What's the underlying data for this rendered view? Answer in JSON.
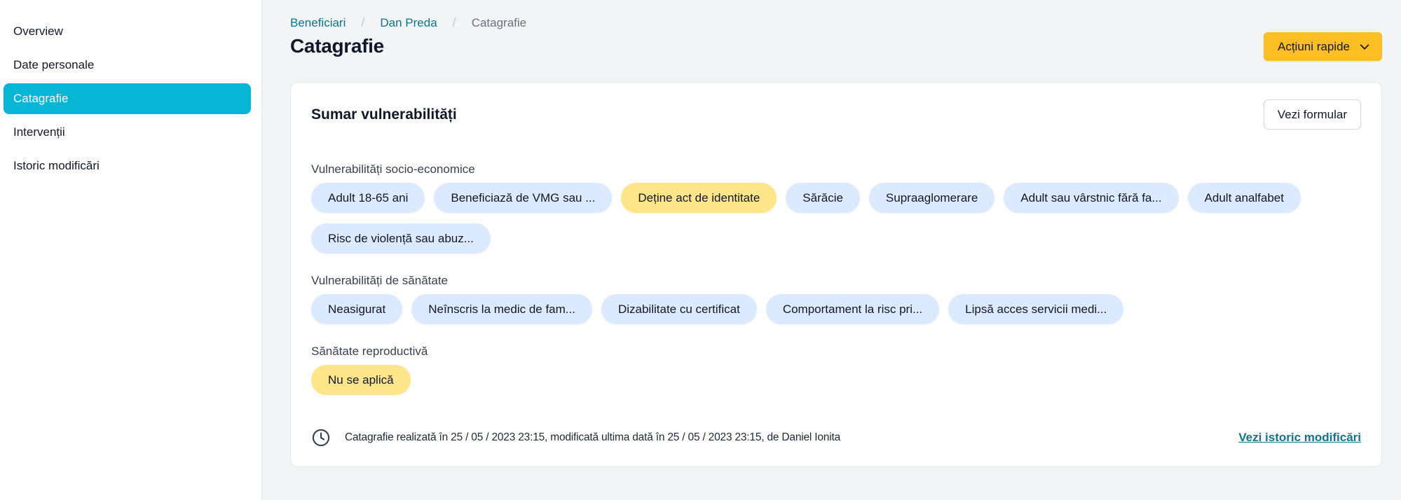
{
  "sidebar": {
    "items": [
      {
        "label": "Overview"
      },
      {
        "label": "Date personale"
      },
      {
        "label": "Catagrafie"
      },
      {
        "label": "Intervenții"
      },
      {
        "label": "Istoric modificări"
      }
    ],
    "active_index": 2
  },
  "breadcrumb": {
    "items": [
      "Beneficiari",
      "Dan Preda",
      "Catagrafie"
    ]
  },
  "header": {
    "title": "Catagrafie",
    "quick_actions_label": "Acțiuni rapide"
  },
  "card": {
    "title": "Sumar vulnerabilități",
    "view_form_label": "Vezi formular",
    "sections": [
      {
        "label": "Vulnerabilități socio-economice",
        "chips": [
          {
            "label": "Adult 18-65 ani",
            "tone": "blue"
          },
          {
            "label": "Beneficiază de VMG sau ...",
            "tone": "blue"
          },
          {
            "label": "Deține act de identitate",
            "tone": "yellow"
          },
          {
            "label": "Sărăcie",
            "tone": "blue"
          },
          {
            "label": "Supraaglomerare",
            "tone": "blue"
          },
          {
            "label": "Adult sau vârstnic fără fa...",
            "tone": "blue"
          },
          {
            "label": "Adult analfabet",
            "tone": "blue"
          },
          {
            "label": "Risc de violență sau abuz...",
            "tone": "blue"
          }
        ]
      },
      {
        "label": "Vulnerabilități de sănătate",
        "chips": [
          {
            "label": "Neasigurat",
            "tone": "blue"
          },
          {
            "label": "Neînscris la medic de fam...",
            "tone": "blue"
          },
          {
            "label": "Dizabilitate cu certificat",
            "tone": "blue"
          },
          {
            "label": "Comportament la risc pri...",
            "tone": "blue"
          },
          {
            "label": "Lipsă acces servicii medi...",
            "tone": "blue"
          }
        ]
      },
      {
        "label": "Sănătate reproductivă",
        "chips": [
          {
            "label": "Nu se aplică",
            "tone": "yellow"
          }
        ]
      }
    ],
    "footer_text": "Catagrafie realizată în 25 / 05 / 2023 23:15, modificată ultima dată în 25 / 05 / 2023 23:15, de Daniel Ionita",
    "history_link_label": "Vezi istoric modificări"
  },
  "icons": {
    "chevron": "chevron-down-icon",
    "clock": "clock-icon"
  },
  "colors": {
    "accent": "#06b6d4",
    "link": "#0e7490",
    "warning": "#fbbf24",
    "chip_blue": "#dbeafe",
    "chip_yellow": "#fde68a"
  }
}
